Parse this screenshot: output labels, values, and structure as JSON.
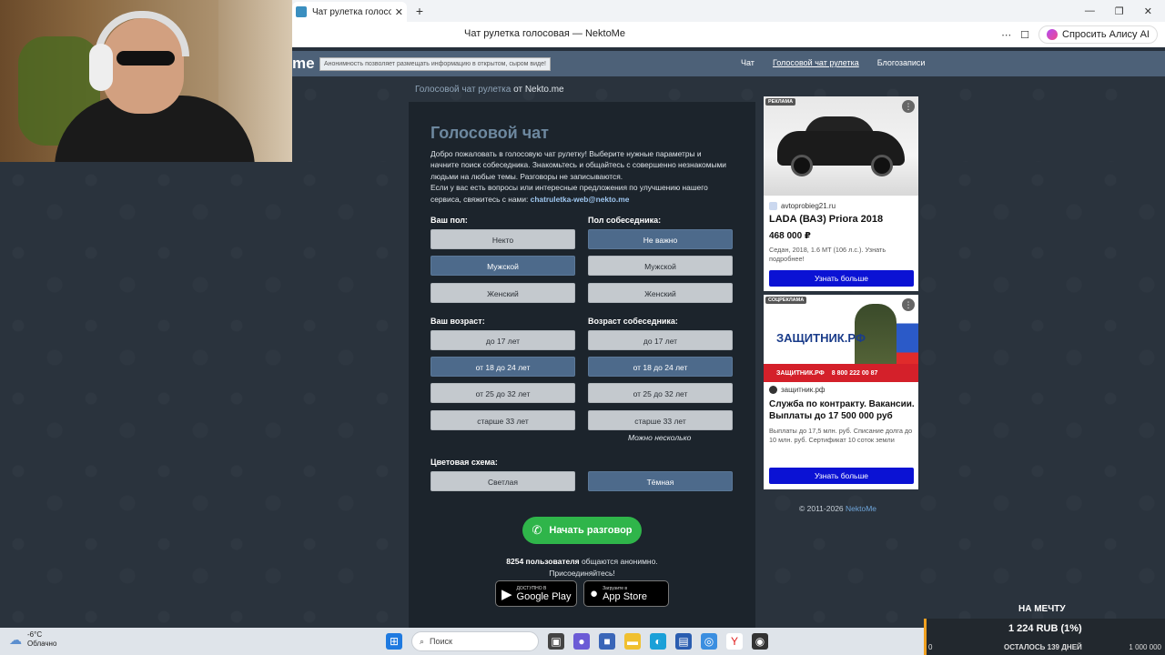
{
  "browser": {
    "tab_title": "Чат рулетка голосовая",
    "tab_close": "✕",
    "new_tab": "+",
    "window_title": "Чат рулетка голосовая — NektoMe",
    "more_icon": "⋯",
    "bookmark_icon": "☐",
    "alice_label": "Спросить Алису AI",
    "win_min": "—",
    "win_max": "❐",
    "win_close": "✕"
  },
  "site": {
    "logo_fragment": "me",
    "notice": "Анонимность позволяет размещать информацию в открытом, сыром виде!",
    "nav": [
      "Чат",
      "Голосовой чат рулетка",
      "Блогозаписи"
    ]
  },
  "breadcrumb": {
    "link": "Голосовой чат рулетка",
    "rest": " от Nekto.me"
  },
  "panel": {
    "title": "Голосовой чат",
    "desc1": "Добро пожаловать в голосовую чат рулетку! Выберите нужные параметры и начните поиск собеседника. Знакомьтесь и общайтесь с совершенно незнакомыми людьми на любые темы. Разговоры не записываются.",
    "desc2": "Если у вас есть вопросы или интересные предложения по улучшению нашего сервиса, свяжитесь с нами: ",
    "email": "chatruletka-web@nekto.me",
    "your_gender_label": "Ваш пол:",
    "partner_gender_label": "Пол собеседника:",
    "your_gender": [
      "Некто",
      "Мужской",
      "Женский"
    ],
    "partner_gender": [
      "Не важно",
      "Мужской",
      "Женский"
    ],
    "your_age_label": "Ваш возраст:",
    "partner_age_label": "Возраст собеседника:",
    "ages": [
      "до 17 лет",
      "от 18 до 24 лет",
      "от 25 до 32 лет",
      "старше 33 лет"
    ],
    "multi_hint": "Можно несколько",
    "scheme_label": "Цветовая схема:",
    "schemes": [
      "Светлая",
      "Тёмная"
    ],
    "start": "Начать разговор",
    "phone_icon": "✆",
    "users_count": "8254 пользователя",
    "users_rest": " общаются анонимно.",
    "join": "Присоединяйтесь!",
    "google_small": "ДОСТУПНО В",
    "google_big": "Google Play",
    "apple_small": "Загрузите в",
    "apple_big": "App Store"
  },
  "ads": {
    "ad1": {
      "badge": "РЕКЛАМА",
      "source": "avtoprobieg21.ru",
      "title": "LADA (ВАЗ) Priora 2018",
      "price": "468 000 ₽",
      "desc": "Седан, 2018, 1.6 MT (106 л.с.). Узнать подробнее!",
      "button": "Узнать больше"
    },
    "ad2": {
      "badge": "СОЦРЕКЛАМА",
      "banner_title": "ЗАЩИТНИК.РФ",
      "banner_bar": "ЗАЩИТНИК.РФ",
      "banner_phone": "8 800 222 00 87",
      "source": "защитник.рф",
      "title": "Служба по контракту. Вакансии. Выплаты до 17 500 000 руб",
      "desc": "Выплаты до 17,5 млн. руб. Списание долга до 10 млн. руб. Сертификат 10 соток земли",
      "button": "Узнать больше"
    },
    "menu_icon": "⋮"
  },
  "footer": {
    "copyright": "© 2011-2026 ",
    "brand": "NektoMe"
  },
  "taskbar": {
    "temp": "-6°C",
    "cond": "Облачно",
    "search_placeholder": "Поиск",
    "weather_icon": "☁",
    "search_icon": "⌕"
  },
  "donation": {
    "goal": "НА МЕЧТУ",
    "amount": "1 224 RUB (1%)",
    "left": "ОСТАЛОСЬ 139 ДНЕЙ",
    "zero": "0",
    "max": "1 000 000"
  }
}
